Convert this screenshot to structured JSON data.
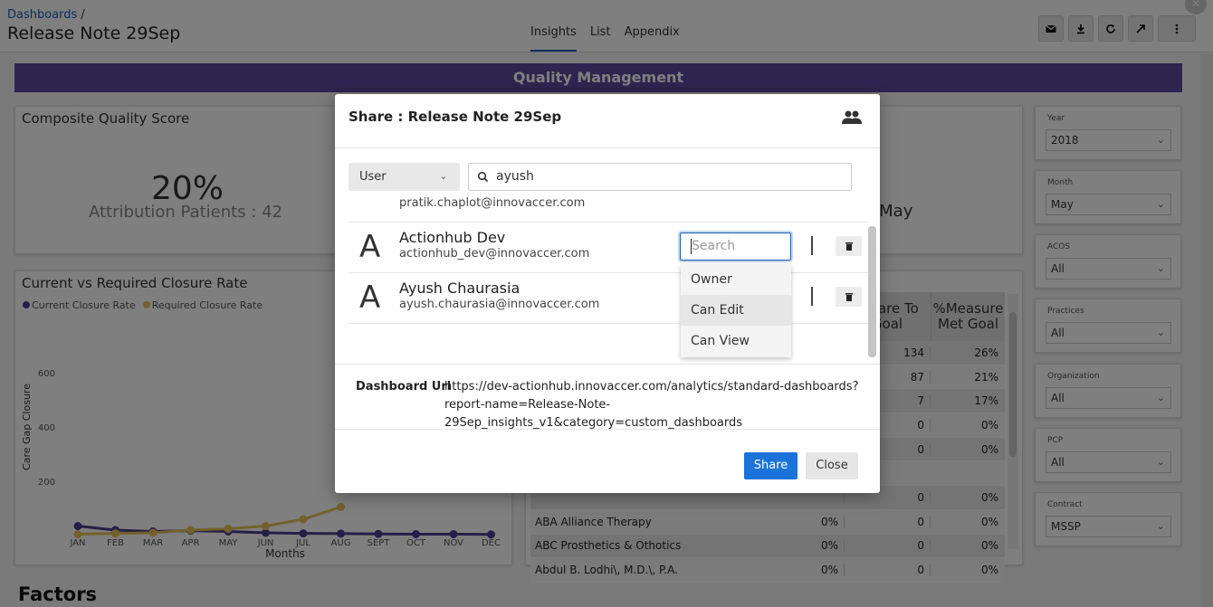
{
  "header": {
    "breadcrumb": "Dashboards",
    "breadcrumb_sep": "/",
    "title": "Release Note 29Sep",
    "tabs": [
      {
        "label": "Insights",
        "active": true
      },
      {
        "label": "List",
        "active": false
      },
      {
        "label": "Appendix",
        "active": false
      }
    ],
    "tools": [
      "mail-icon",
      "download-icon",
      "refresh-icon",
      "expand-icon",
      "more-vertical-icon"
    ]
  },
  "banner": {
    "title": "Quality Management"
  },
  "kpi": {
    "title": "Composite Quality Score",
    "value": "20%",
    "subtitle": "Attribution Patients : 42",
    "partial_text": "n May"
  },
  "closure_chart": {
    "title": "Current vs Required Closure Rate",
    "legend": [
      {
        "name": "Current Closure Rate",
        "color": "#4a3f8f"
      },
      {
        "name": "Required Closure Rate",
        "color": "#e6c35a"
      }
    ]
  },
  "chart_data": {
    "type": "line",
    "x": [
      "JAN",
      "FEB",
      "MAR",
      "APR",
      "MAY",
      "JUN",
      "JUL",
      "AUG",
      "SEPT",
      "OCT",
      "NOV",
      "DEC"
    ],
    "xlabel": "Months",
    "ylabel": "Care Gap Closure",
    "yticks": [
      200,
      400,
      600
    ],
    "ylim": [
      0,
      640
    ],
    "series": [
      {
        "name": "Current Closure Rate",
        "color": "#4a3f8f",
        "values": [
          35,
          20,
          15,
          18,
          15,
          10,
          8,
          7,
          6,
          5,
          5,
          4
        ]
      },
      {
        "name": "Required Closure Rate",
        "color": "#e6c35a",
        "values": [
          5,
          8,
          10,
          20,
          25,
          35,
          60,
          105,
          null,
          null,
          null,
          null
        ]
      }
    ]
  },
  "table": {
    "headers": [
      "n Care To Goal",
      "%Measure Met Goal"
    ],
    "rows": [
      {
        "name": "",
        "a": "",
        "b": "134",
        "c": "26%"
      },
      {
        "name": "",
        "a": "",
        "b": "87",
        "c": "21%"
      },
      {
        "name": "",
        "a": "",
        "b": "7",
        "c": "17%"
      },
      {
        "name": "",
        "a": "",
        "b": "0",
        "c": "0%"
      },
      {
        "name": "",
        "a": "",
        "b": "0",
        "c": "0%"
      },
      {
        "name": "",
        "a": "",
        "b": "",
        "c": ""
      },
      {
        "name": "",
        "a": "",
        "b": "0",
        "c": "0%"
      },
      {
        "name": "ABA Alliance Therapy",
        "a": "0%",
        "b": "0",
        "c": "0%"
      },
      {
        "name": "ABC Prosthetics & Othotics",
        "a": "0%",
        "b": "0",
        "c": "0%"
      },
      {
        "name": "Abdul B. Lodhi\\, M.D.\\, P.A.",
        "a": "0%",
        "b": "0",
        "c": "0%"
      }
    ]
  },
  "filters": [
    {
      "label": "Year",
      "value": "2018"
    },
    {
      "label": "Month",
      "value": "May"
    },
    {
      "label": "ACOS",
      "value": "All"
    },
    {
      "label": "Practices",
      "value": "All"
    },
    {
      "label": "Organization",
      "value": "All"
    },
    {
      "label": "PCP",
      "value": "All"
    },
    {
      "label": "Contract",
      "value": "MSSP"
    }
  ],
  "factors_title": "Factors",
  "modal": {
    "title": "Share : Release Note 29Sep",
    "type_select": "User",
    "search_value": "ayush",
    "users": [
      {
        "initial": "",
        "name": "",
        "email": "pratik.chaplot@innovaccer.com"
      },
      {
        "initial": "A",
        "name": "Actionhub Dev",
        "email": "actionhub_dev@innovaccer.com",
        "perm_placeholder": "Search"
      },
      {
        "initial": "A",
        "name": "Ayush Chaurasia",
        "email": "ayush.chaurasia@innovaccer.com"
      }
    ],
    "permission_options": [
      "Owner",
      "Can Edit",
      "Can View"
    ],
    "url_label": "Dashboard Url",
    "url": "https://dev-actionhub.innovaccer.com/analytics/standard-dashboards?report-name=Release-Note-29Sep_insights_v1&category=custom_dashboards",
    "share_label": "Share",
    "close_label": "Close"
  }
}
